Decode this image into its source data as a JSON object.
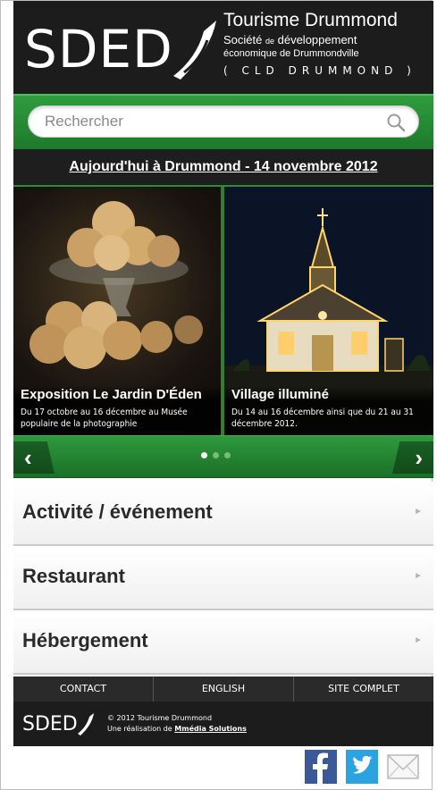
{
  "header": {
    "logo_text": "SDED",
    "brand_title": "Tourisme Drummond",
    "brand_sub1_prefix": "Société ",
    "brand_sub1_small": "de",
    "brand_sub1_suffix": " développement",
    "brand_sub2": "économique de Drummondville",
    "brand_sub3": "( CLD DRUMMOND )"
  },
  "search": {
    "placeholder": "Rechercher",
    "icon": "search-icon"
  },
  "today": {
    "label": "Aujourd'hui à Drummond - 14 novembre 2012"
  },
  "slides": [
    {
      "title": "Exposition Le Jardin D'Éden",
      "description": "Du 17 octobre au 16 décembre au Musée populaire de la photographie"
    },
    {
      "title": "Village illuminé",
      "description": "Du 14 au 16 décembre ainsi que du 21 au 31 décembre 2012."
    }
  ],
  "carousel": {
    "prev_label": "‹",
    "next_label": "›",
    "dots_count": 3,
    "active_dot": 0
  },
  "menu": {
    "items": [
      {
        "label": "Activité / événement"
      },
      {
        "label": "Restaurant"
      },
      {
        "label": "Hébergement"
      }
    ],
    "chevron": "►"
  },
  "footer": {
    "links": [
      {
        "label": "CONTACT"
      },
      {
        "label": "ENGLISH"
      },
      {
        "label": "SITE COMPLET"
      }
    ],
    "logo_text": "SDED",
    "copyright": "© 2012 Tourisme Drummond",
    "credit_prefix": "Une réalisation de ",
    "credit_link": "Mmédia Solutions"
  },
  "social": {
    "icons": [
      "facebook-icon",
      "twitter-icon",
      "email-icon"
    ],
    "colors": {
      "facebook": "#3b5998",
      "twitter": "#2aa3e0"
    }
  },
  "colors": {
    "accent_green": "#2e9a3c",
    "header_dark": "#1c1c1c"
  }
}
